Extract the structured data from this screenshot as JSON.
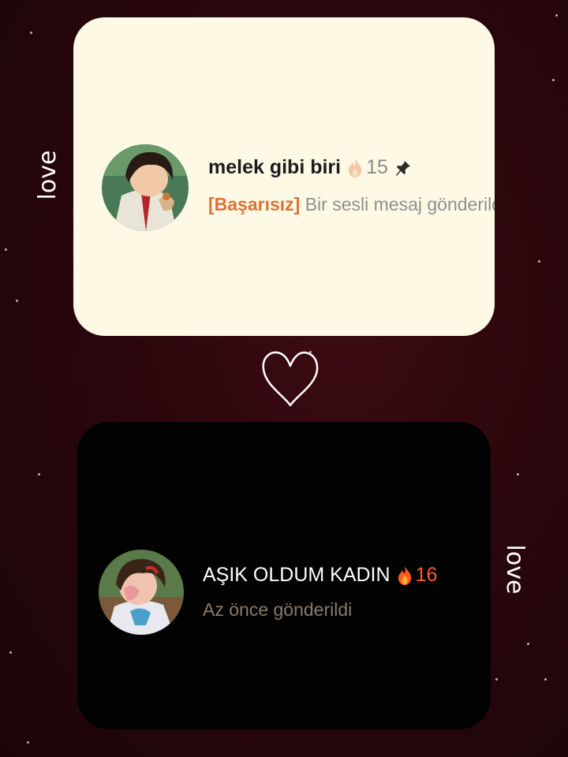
{
  "side_labels": {
    "top": "love",
    "bottom": "love"
  },
  "cards": [
    {
      "name": "melek gibi biri",
      "streak": "15",
      "streak_icon": "fire-icon-greyed",
      "pinned": true,
      "status": "[Başarısız]",
      "preview": "Bir sesli mesaj gönderildi"
    },
    {
      "name": "AŞIK OLDUM KADIN",
      "streak": "16",
      "streak_icon": "fire-icon",
      "preview": "Az önce gönderildi"
    }
  ],
  "colors": {
    "background": "#2a070c",
    "light_card": "#fdf9e5",
    "dark_card": "#020202",
    "failed_status": "#d9733a",
    "streak_active": "#ff5a2a"
  }
}
